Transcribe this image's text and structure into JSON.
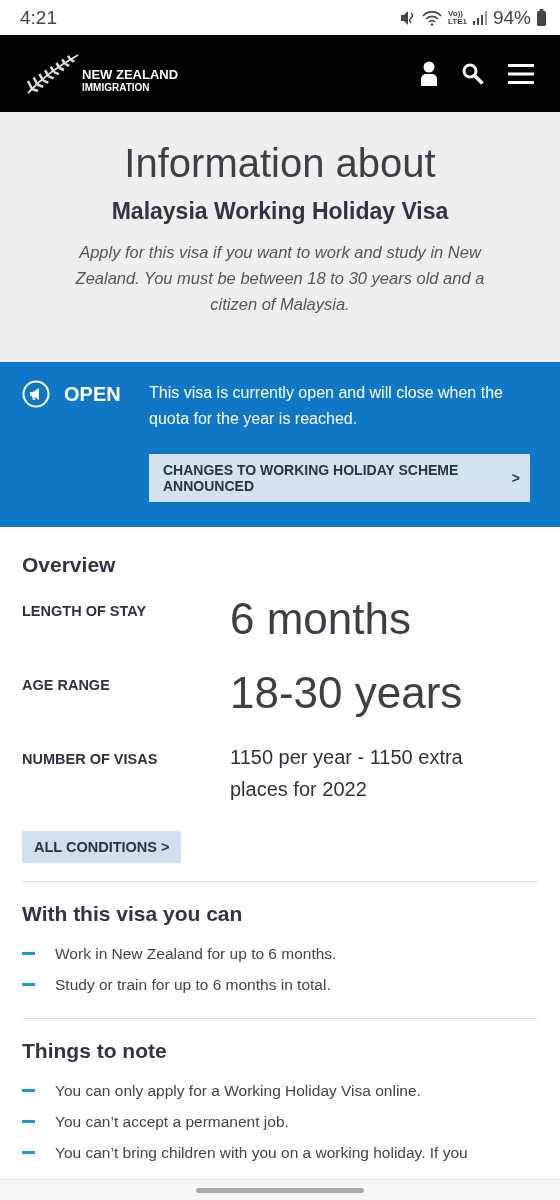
{
  "status_bar": {
    "time": "4:21",
    "network_top": "Vo))",
    "network_bottom": "LTE1",
    "battery": "94%"
  },
  "header": {
    "logo_line1": "NEW ZEALAND",
    "logo_line2": "IMMIGRATION"
  },
  "hero": {
    "kicker": "Information about",
    "title": "Malaysia Working Holiday Visa",
    "description": "Apply for this visa if you want to work and study in New Zealand. You must be between 18 to 30 years old and a citizen of Malaysia."
  },
  "status_banner": {
    "label": "OPEN",
    "message": "This visa is currently open and will close when the quota for the year is reached.",
    "link": "CHANGES TO WORKING HOLIDAY SCHEME ANNOUNCED",
    "link_arrow": ">"
  },
  "overview": {
    "heading": "Overview",
    "rows": [
      {
        "label": "LENGTH OF STAY",
        "value": "6 months",
        "kind": "large"
      },
      {
        "label": "AGE RANGE",
        "value": "18-30 years",
        "kind": "large"
      },
      {
        "label": "NUMBER OF VISAS",
        "value": "1150 per year - 1150 extra places for 2022",
        "kind": "text"
      }
    ],
    "button": "ALL CONDITIONS >"
  },
  "sections": [
    {
      "heading": "With this visa you can",
      "items": [
        "Work in New Zealand for up to 6 months.",
        "Study or train for up to 6 months in total."
      ]
    },
    {
      "heading": "Things to note",
      "items": [
        "You can only apply for a Working Holiday Visa online.",
        "You can’t accept a permanent job.",
        "You can’t bring children with you on a working holiday. If you"
      ]
    }
  ]
}
